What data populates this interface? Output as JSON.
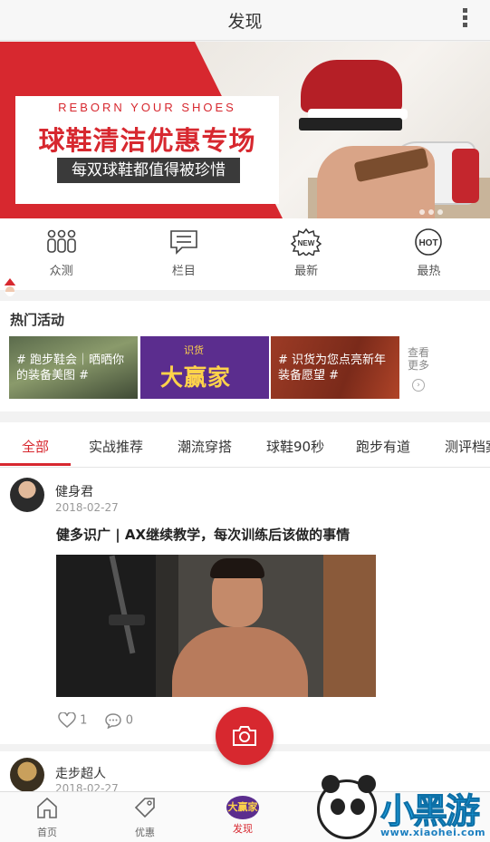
{
  "header": {
    "title": "发现"
  },
  "banner": {
    "en_line": "REBORN YOUR SHOES",
    "title": "球鞋清洁优惠专场",
    "subtitle": "每双球鞋都值得被珍惜"
  },
  "categories": [
    {
      "label": "众测",
      "icon": "people-icon"
    },
    {
      "label": "栏目",
      "icon": "chat-list-icon"
    },
    {
      "label": "最新",
      "icon": "new-badge-icon",
      "badge": "NEW"
    },
    {
      "label": "最热",
      "icon": "hot-badge-icon",
      "badge": "HOT"
    }
  ],
  "hot": {
    "title": "热门活动",
    "tiles": [
      {
        "text": "# 跑步鞋会｜晒晒你的装备美图 #"
      },
      {
        "badge": "识货",
        "text": "大赢家"
      },
      {
        "text": "# 识货为您点亮新年装备愿望 #"
      }
    ],
    "more": "查看更多"
  },
  "tabs": [
    "全部",
    "实战推荐",
    "潮流穿搭",
    "球鞋90秒",
    "跑步有道",
    "测评档案"
  ],
  "posts": [
    {
      "user": "健身君",
      "date": "2018-02-27",
      "title": "健多识广 | AX继续教学，每次训练后该做的事情",
      "likes": "1",
      "comments": "0"
    },
    {
      "user": "走步超人",
      "date": "2018-02-27"
    }
  ],
  "nav": [
    {
      "label": "首页",
      "icon": "home-icon"
    },
    {
      "label": "优惠",
      "icon": "tag-icon"
    },
    {
      "label": "发现",
      "icon": "discover-icon",
      "icon_text": "大赢家"
    }
  ],
  "watermark": {
    "text": "小黑游戏",
    "url": "www.xiaohei.com"
  },
  "colors": {
    "accent": "#d7282f",
    "header_bg": "#f7f7f7"
  }
}
